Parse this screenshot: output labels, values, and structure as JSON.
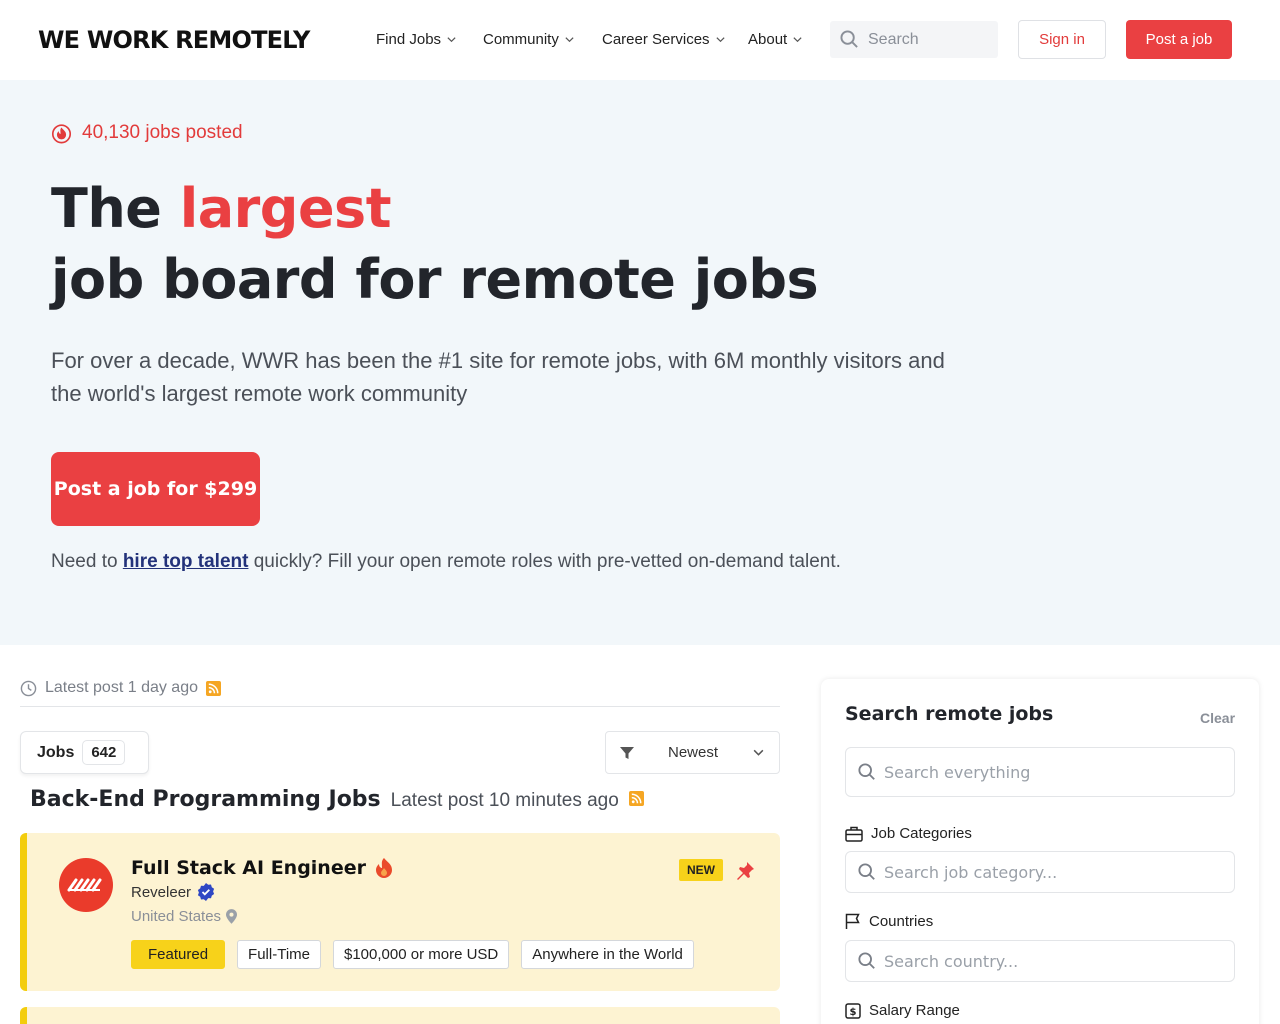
{
  "header": {
    "logo": "WE WORK REMOTELY",
    "nav": [
      "Find Jobs",
      "Community",
      "Career Services",
      "About"
    ],
    "search_placeholder": "Search",
    "signin_label": "Sign in",
    "post_job_label": "Post a job"
  },
  "hero": {
    "jobs_posted": "40,130 jobs posted",
    "title_part1": "The ",
    "title_accent": "largest",
    "title_line2": "job board for remote jobs",
    "subtitle": "For over a decade, WWR has been the #1 site for remote jobs, with 6M monthly visitors and the world's largest remote work community",
    "cta_label": "Post a job for $299",
    "talent_prefix": "Need to ",
    "talent_link": "hire top talent",
    "talent_suffix": " quickly? Fill your open remote roles with pre-vetted on-demand talent."
  },
  "listing": {
    "latest_post": "Latest post 1 day ago",
    "jobs_tab_label": "Jobs",
    "jobs_count": "642",
    "sort_label": "Newest",
    "section_title": "Back-End Programming Jobs",
    "section_latest": "Latest post 10 minutes ago",
    "jobs": [
      {
        "title": "Full Stack AI Engineer",
        "company": "Reveleer",
        "location": "United States",
        "badge": "NEW",
        "tags": [
          "Featured",
          "Full-Time",
          "$100,000 or more USD",
          "Anywhere in the World"
        ]
      }
    ]
  },
  "sidebar": {
    "title": "Search remote jobs",
    "clear_label": "Clear",
    "search_placeholder": "Search everything",
    "categories_label": "Job Categories",
    "categories_placeholder": "Search job category...",
    "countries_label": "Countries",
    "countries_placeholder": "Search country...",
    "salary_label": "Salary Range"
  },
  "colors": {
    "brand_red": "#ea4042",
    "hero_bg": "#f2f7fa",
    "featured_bg": "#fdf3d2",
    "featured_yellow": "#f7d21a",
    "link_blue": "#23327a"
  },
  "icons": [
    "chevron-down-icon",
    "search-icon",
    "fire-icon",
    "clock-icon",
    "rss-icon",
    "filter-icon",
    "verified-icon",
    "location-pin-icon",
    "pin-icon",
    "briefcase-icon",
    "flag-icon",
    "dollar-icon"
  ]
}
